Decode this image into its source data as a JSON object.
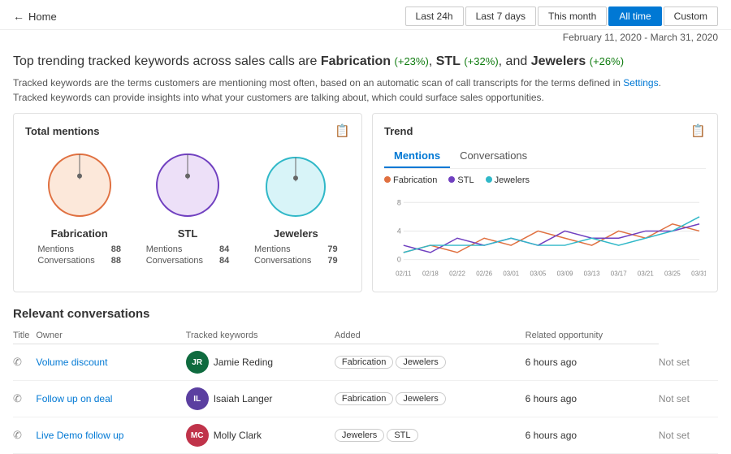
{
  "header": {
    "back_label": "Home",
    "filters": [
      {
        "label": "Last 24h",
        "active": false
      },
      {
        "label": "Last 7 days",
        "active": false
      },
      {
        "label": "This month",
        "active": false
      },
      {
        "label": "All time",
        "active": true
      },
      {
        "label": "Custom",
        "active": false
      }
    ]
  },
  "date_range": "February 11, 2020 - March 31, 2020",
  "summary": {
    "title_prefix": "Top trending tracked keywords across sales calls are ",
    "keywords": [
      {
        "word": "Fabrication",
        "change": "+23%"
      },
      {
        "word": "STL",
        "change": "+32%"
      },
      {
        "word": "Jewelers",
        "change": "+26%"
      }
    ],
    "desc_line1": "Tracked keywords are the terms customers are mentioning most often, based on an automatic scan of call transcripts for the terms defined in ",
    "settings_link": "Settings",
    "desc_line2": ".",
    "desc_line3": "Tracked keywords can provide insights into what your customers are talking about, which could surface sales opportunities."
  },
  "total_mentions": {
    "title": "Total mentions",
    "items": [
      {
        "name": "Fabrication",
        "color": "#e07040",
        "bg": "#fce8da",
        "radius": 38,
        "mentions": 88,
        "conversations": 88
      },
      {
        "name": "STL",
        "color": "#7040c0",
        "bg": "#ede0f8",
        "radius": 38,
        "mentions": 84,
        "conversations": 84
      },
      {
        "name": "Jewelers",
        "color": "#30b8c8",
        "bg": "#d8f4f8",
        "radius": 36,
        "mentions": 79,
        "conversations": 79
      }
    ],
    "mentions_label": "Mentions",
    "conversations_label": "Conversations"
  },
  "trend": {
    "title": "Trend",
    "tabs": [
      "Mentions",
      "Conversations"
    ],
    "active_tab": "Mentions",
    "legend": [
      {
        "label": "Fabrication",
        "color": "#e07040"
      },
      {
        "label": "STL",
        "color": "#7040c0"
      },
      {
        "label": "Jewelers",
        "color": "#30b8c8"
      }
    ],
    "x_labels": [
      "02/11",
      "02/18",
      "02/22",
      "02/26",
      "03/01",
      "03/05",
      "03/09",
      "03/13",
      "03/17",
      "03/21",
      "03/25",
      "03/31"
    ],
    "y_labels": [
      "8",
      "4",
      "0"
    ]
  },
  "conversations": {
    "title": "Relevant conversations",
    "columns": [
      "Title",
      "Owner",
      "Tracked keywords",
      "Added",
      "Related opportunity"
    ],
    "rows": [
      {
        "title": "Volume discount",
        "owner_name": "Jamie Reding",
        "owner_initials": "JR",
        "owner_color": "#0f6b3f",
        "keywords": [
          "Fabrication",
          "Jewelers"
        ],
        "added": "6 hours ago",
        "related": "Not set"
      },
      {
        "title": "Follow up on deal",
        "owner_name": "Isaiah Langer",
        "owner_initials": "IL",
        "owner_color": "#5b3fa0",
        "keywords": [
          "Fabrication",
          "Jewelers"
        ],
        "added": "6 hours ago",
        "related": "Not set"
      },
      {
        "title": "Live Demo follow up",
        "owner_name": "Molly Clark",
        "owner_initials": "MC",
        "owner_color": "#c0334a",
        "keywords": [
          "Jewelers",
          "STL"
        ],
        "added": "6 hours ago",
        "related": "Not set"
      }
    ]
  }
}
